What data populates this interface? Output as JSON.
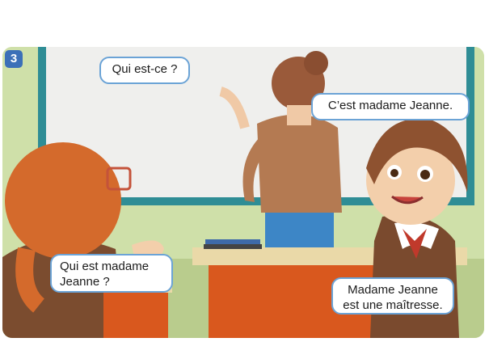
{
  "badge": "3",
  "bubbles": {
    "q1": "Qui est-ce ?",
    "a1": "C’est madame Jeanne.",
    "q2_line1": "Qui est madame",
    "q2_line2": "Jeanne ?",
    "a2_line1": "Madame Jeanne",
    "a2_line2": "est une maîtresse."
  },
  "colors": {
    "wall": "#cfe0a9",
    "board_frame": "#2f8d95",
    "board": "#eeeeec",
    "bubble_border": "#6ba3d6",
    "badge": "#3c70b8",
    "desk": "#d9581e",
    "teacher_sweater": "#b47a52",
    "teacher_pants": "#3d86c6"
  }
}
